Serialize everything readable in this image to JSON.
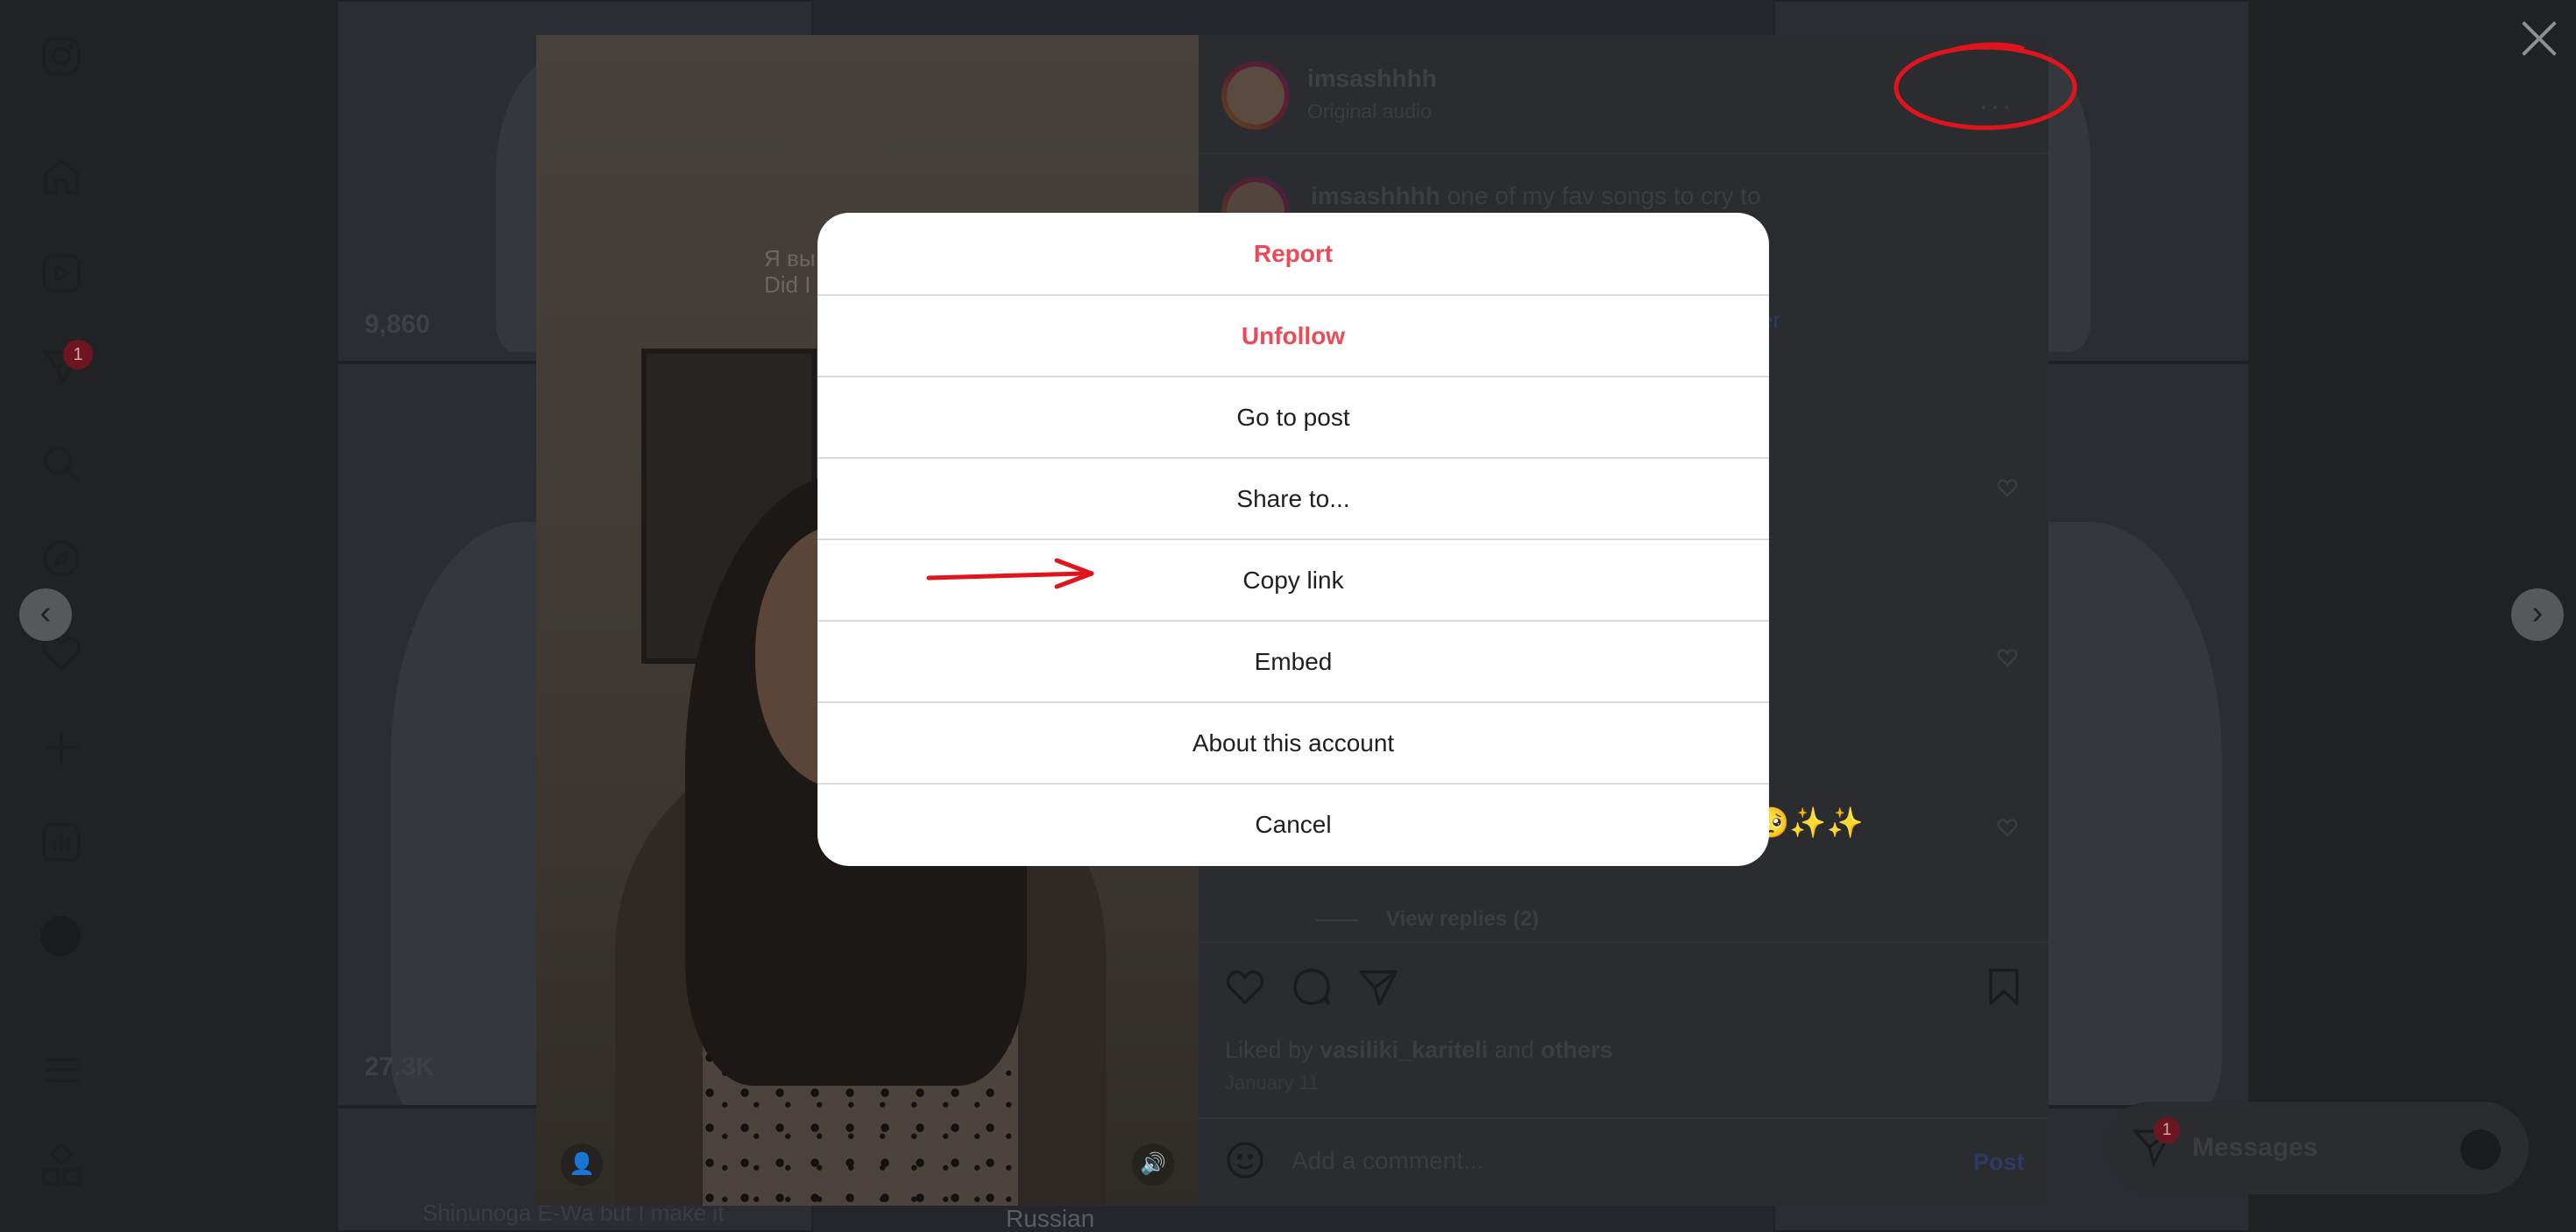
{
  "sidebar": {
    "items": [
      {
        "icon": "instagram-logo-icon"
      },
      {
        "icon": "home-icon"
      },
      {
        "icon": "reels-icon"
      },
      {
        "icon": "messenger-icon",
        "badge": "1"
      },
      {
        "icon": "search-icon"
      },
      {
        "icon": "explore-icon"
      },
      {
        "icon": "heart-icon"
      },
      {
        "icon": "create-icon"
      },
      {
        "icon": "dashboard-icon"
      },
      {
        "icon": "profile-avatar-icon"
      },
      {
        "icon": "more-menu-icon"
      },
      {
        "icon": "also-from-meta-icon"
      }
    ]
  },
  "feed": {
    "tile_views": [
      "9,860",
      "27.3K"
    ],
    "tile_captions": [
      "Shinunoga E-Wa but I make it",
      "Russian"
    ]
  },
  "post": {
    "username": "imsashhhh",
    "audio": "Original audio",
    "more_label": "···",
    "caption_user": "imsashhhh",
    "caption_text": "one of my fav songs to cry to",
    "caption_link": "ver",
    "emoji_row": "🥺✨✨",
    "view_replies": "View replies (2)",
    "liked_prefix": "Liked by",
    "liked_user": "vasiliki_kariteli",
    "liked_and": "and",
    "liked_others": "others",
    "date": "January 11",
    "comment_placeholder": "Add a comment...",
    "post_button": "Post",
    "video_subtitle": [
      "Я вы",
      "Did I"
    ]
  },
  "dialog": {
    "items": [
      {
        "label": "Report",
        "style": "danger"
      },
      {
        "label": "Unfollow",
        "style": "danger"
      },
      {
        "label": "Go to post",
        "style": "normal"
      },
      {
        "label": "Share to...",
        "style": "normal"
      },
      {
        "label": "Copy link",
        "style": "normal"
      },
      {
        "label": "Embed",
        "style": "normal"
      },
      {
        "label": "About this account",
        "style": "normal"
      },
      {
        "label": "Cancel",
        "style": "normal"
      }
    ]
  },
  "messages": {
    "label": "Messages",
    "badge": "1"
  },
  "colors": {
    "danger": "#ed4956",
    "annotation": "#e0141c",
    "link": "#0095f6"
  }
}
